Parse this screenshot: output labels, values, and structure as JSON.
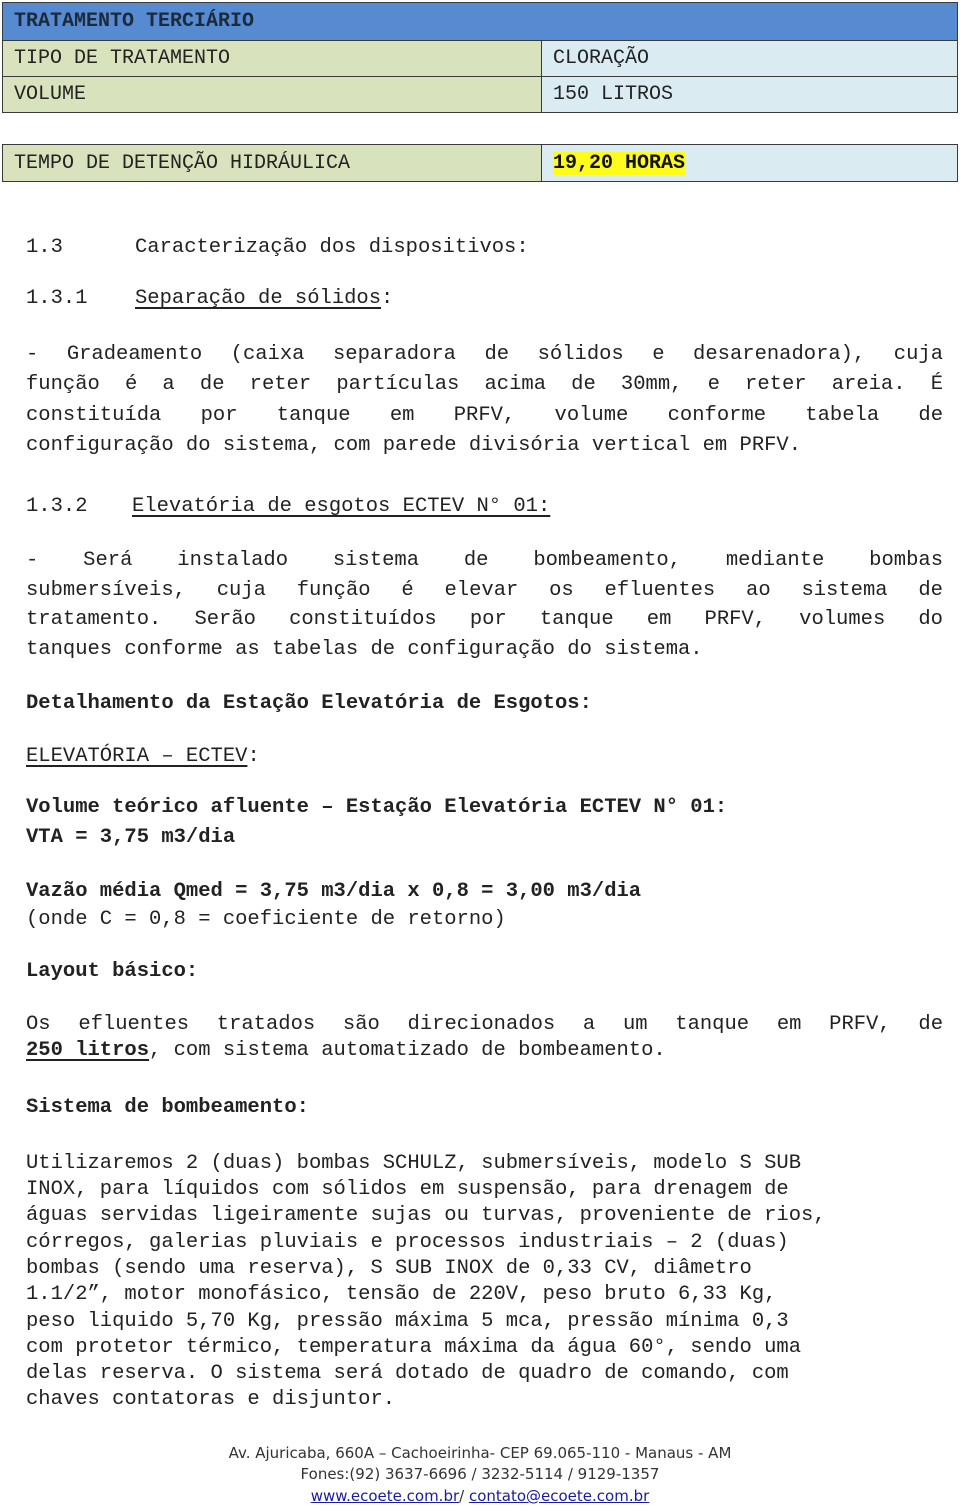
{
  "table1": {
    "header": "TRATAMENTO TERCIÁRIO",
    "rows": [
      {
        "label": "TIPO DE TRATAMENTO",
        "value": "CLORAÇÃO"
      },
      {
        "label": "VOLUME",
        "value": "150 LITROS"
      }
    ]
  },
  "table2": {
    "label": "TEMPO DE DETENÇÃO HIDRÁULICA",
    "value": "19,20 HORAS",
    "highlight_color": "#fffb1a"
  },
  "section_1_3": {
    "number": "1.3",
    "title": "Caracterização dos dispositivos:"
  },
  "section_1_3_1": {
    "number": "1.3.1",
    "title": "Separação de sólidos",
    "colon": ":",
    "lines": [
      "- Gradeamento (caixa separadora de sólidos e desarenadora), cuja",
      "função é a de reter partículas acima de 30mm, e reter areia. É",
      "constituída por tanque em PRFV, volume conforme tabela de",
      "configuração do sistema, com parede divisória vertical em PRFV."
    ]
  },
  "section_1_3_2": {
    "number": "1.3.2",
    "title": "Elevatória de esgotos ECTEV N° 01:",
    "lines": [
      "- Será instalado sistema de bombeamento, mediante bombas",
      "submersíveis, cuja função é elevar os efluentes ao sistema de",
      "tratamento. Serão constituídos por tanque em PRFV, volumes do",
      "tanques conforme as tabelas de configuração do sistema."
    ]
  },
  "detail": {
    "heading": "Detalhamento da Estação Elevatória de Esgotos:",
    "sub_heading": "ELEVATÓRIA – ECTEV",
    "sub_colon": ":",
    "volume_title": "Volume teórico afluente – Estação Elevatória ECTEV N° 01:",
    "vta": "VTA = 3,75 m3/dia",
    "vazao": "Vazão média Qmed = 3,75 m3/dia x 0,8 = 3,00 m3/dia",
    "coef": "(onde C = 0,8 = coeficiente de retorno)"
  },
  "layout": {
    "heading": "Layout básico:",
    "line1": "Os efluentes tratados são direcionados a um tanque em PRFV, de",
    "line2_bold": "250 litros",
    "line2_rest": ", com sistema automatizado de bombeamento."
  },
  "pumping": {
    "heading": "Sistema de bombeamento:",
    "lines": [
      "Utilizaremos 2 (duas) bombas SCHULZ, submersíveis, modelo S SUB",
      "INOX, para líquidos com sólidos em suspensão, para drenagem de",
      "águas servidas ligeiramente sujas ou turvas, proveniente de rios,",
      "córregos, galerias pluviais e processos industriais – 2 (duas)",
      "bombas (sendo uma reserva), S SUB INOX de 0,33 CV, diâmetro",
      "1.1/2”, motor monofásico, tensão de 220V, peso bruto 6,33 Kg,",
      "peso liquido 5,70 Kg, pressão máxima 5 mca, pressão mínima 0,3",
      "com protetor térmico, temperatura máxima da água 60°, sendo uma",
      "delas reserva. O sistema será dotado de quadro de comando, com",
      "chaves contatoras e disjuntor."
    ]
  },
  "footer": {
    "address": "Av. Ajuricaba, 660A – Cachoeirinha- CEP 69.065-110 - Manaus  - AM",
    "phones": "Fones:(92) 3637-6696  /  3232-5114  /  9129-1357",
    "website": "www.ecoete.com.br",
    "separator": "/  ",
    "email": "contato@ecoete.com.br"
  }
}
